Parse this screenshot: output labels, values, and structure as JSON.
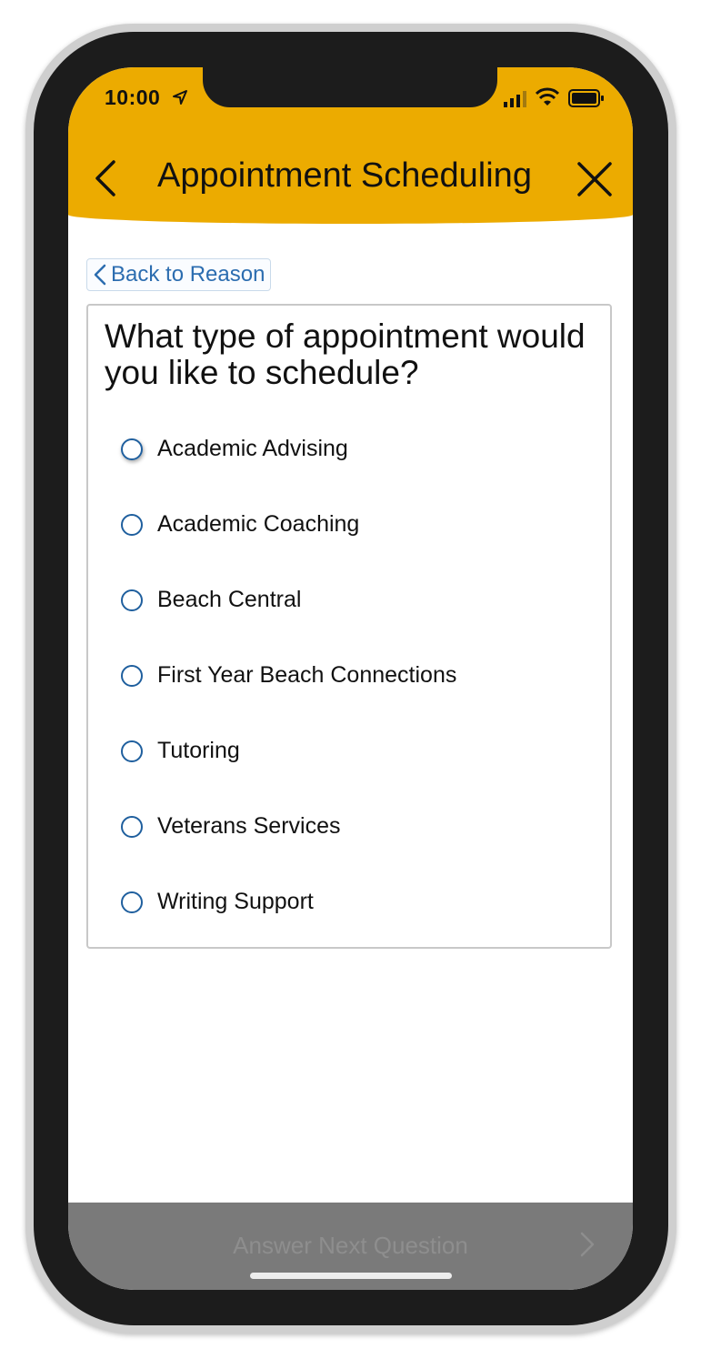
{
  "status_bar": {
    "time": "10:00"
  },
  "header": {
    "title": "Appointment Scheduling",
    "color": "#ecab00"
  },
  "back_link": {
    "label": "Back to Reason"
  },
  "question": {
    "text": "What type of appointment would you like to schedule?"
  },
  "options": [
    {
      "label": "Academic Advising",
      "selected": false
    },
    {
      "label": "Academic Coaching",
      "selected": false
    },
    {
      "label": "Beach Central",
      "selected": false
    },
    {
      "label": "First Year Beach Connections",
      "selected": false
    },
    {
      "label": "Tutoring",
      "selected": false
    },
    {
      "label": "Veterans Services",
      "selected": false
    },
    {
      "label": "Writing Support",
      "selected": false
    }
  ],
  "footer": {
    "button_label": "Answer Next Question",
    "disabled": true
  },
  "icons": {
    "back": "chevron-left-icon",
    "close": "close-icon",
    "next": "chevron-right-icon",
    "location": "location-arrow-icon",
    "signal": "signal-icon",
    "wifi": "wifi-icon",
    "battery": "battery-icon"
  }
}
